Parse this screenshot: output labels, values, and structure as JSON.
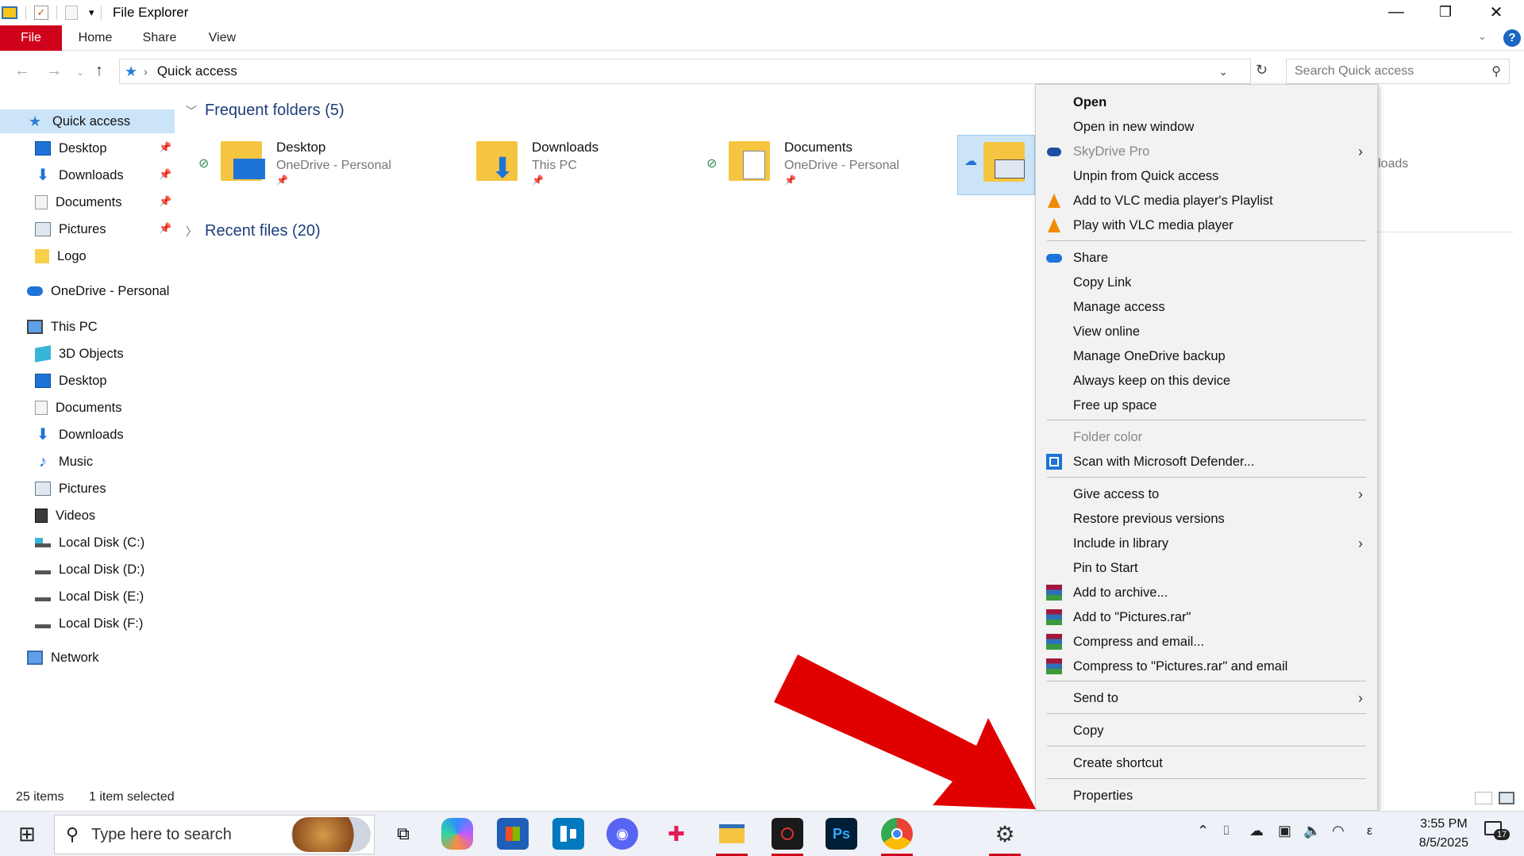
{
  "window": {
    "title": "File Explorer",
    "controls": {
      "minimize": "—",
      "restore": "❐",
      "close": "✕"
    }
  },
  "ribbon": {
    "tabs": [
      "File",
      "Home",
      "Share",
      "View"
    ],
    "help": "?"
  },
  "address": {
    "path": "Quick access",
    "search_placeholder": "Search Quick access"
  },
  "sidebar": {
    "quick_access": "Quick access",
    "quick_items": [
      "Desktop",
      "Downloads",
      "Documents",
      "Pictures",
      "Logo"
    ],
    "onedrive": "OneDrive - Personal",
    "this_pc": "This PC",
    "pc_items": [
      "3D Objects",
      "Desktop",
      "Documents",
      "Downloads",
      "Music",
      "Pictures",
      "Videos",
      "Local Disk (C:)",
      "Local Disk (D:)",
      "Local Disk (E:)",
      "Local Disk (F:)"
    ],
    "network": "Network"
  },
  "main": {
    "frequent_header": "Frequent folders (5)",
    "recent_header": "Recent files (20)",
    "folders": [
      {
        "name": "Desktop",
        "sub": "OneDrive - Personal"
      },
      {
        "name": "Downloads",
        "sub": "This PC"
      },
      {
        "name": "Documents",
        "sub": "OneDrive - Personal"
      },
      {
        "name": "",
        "sub": ""
      }
    ],
    "partial_right": "loads"
  },
  "context_menu": {
    "group1": [
      "Open",
      "Open in new window",
      "SkyDrive Pro",
      "Unpin from Quick access",
      "Add to VLC media player's Playlist",
      "Play with VLC media player"
    ],
    "group2": [
      "Share",
      "Copy Link",
      "Manage access",
      "View online",
      "Manage OneDrive backup",
      "Always keep on this device",
      "Free up space"
    ],
    "group3": [
      "Folder color",
      "Scan with Microsoft Defender..."
    ],
    "group4": [
      "Give access to",
      "Restore previous versions",
      "Include in library",
      "Pin to Start",
      "Add to archive...",
      "Add to \"Pictures.rar\"",
      "Compress and email...",
      "Compress to \"Pictures.rar\" and email"
    ],
    "group5": [
      "Send to"
    ],
    "group6": [
      "Copy"
    ],
    "group7": [
      "Create shortcut"
    ],
    "group8": [
      "Properties"
    ]
  },
  "statusbar": {
    "items": "25 items",
    "selected": "1 item selected"
  },
  "taskbar": {
    "search_placeholder": "Type here to search",
    "time": "3:55 PM",
    "date": "8/5/2025",
    "notification_count": "17",
    "lang": "ε"
  },
  "colors": {
    "file_tab": "#d0021b",
    "selection": "#cce4f7",
    "section_header": "#1e3e7a",
    "arrow": "#e00000"
  }
}
